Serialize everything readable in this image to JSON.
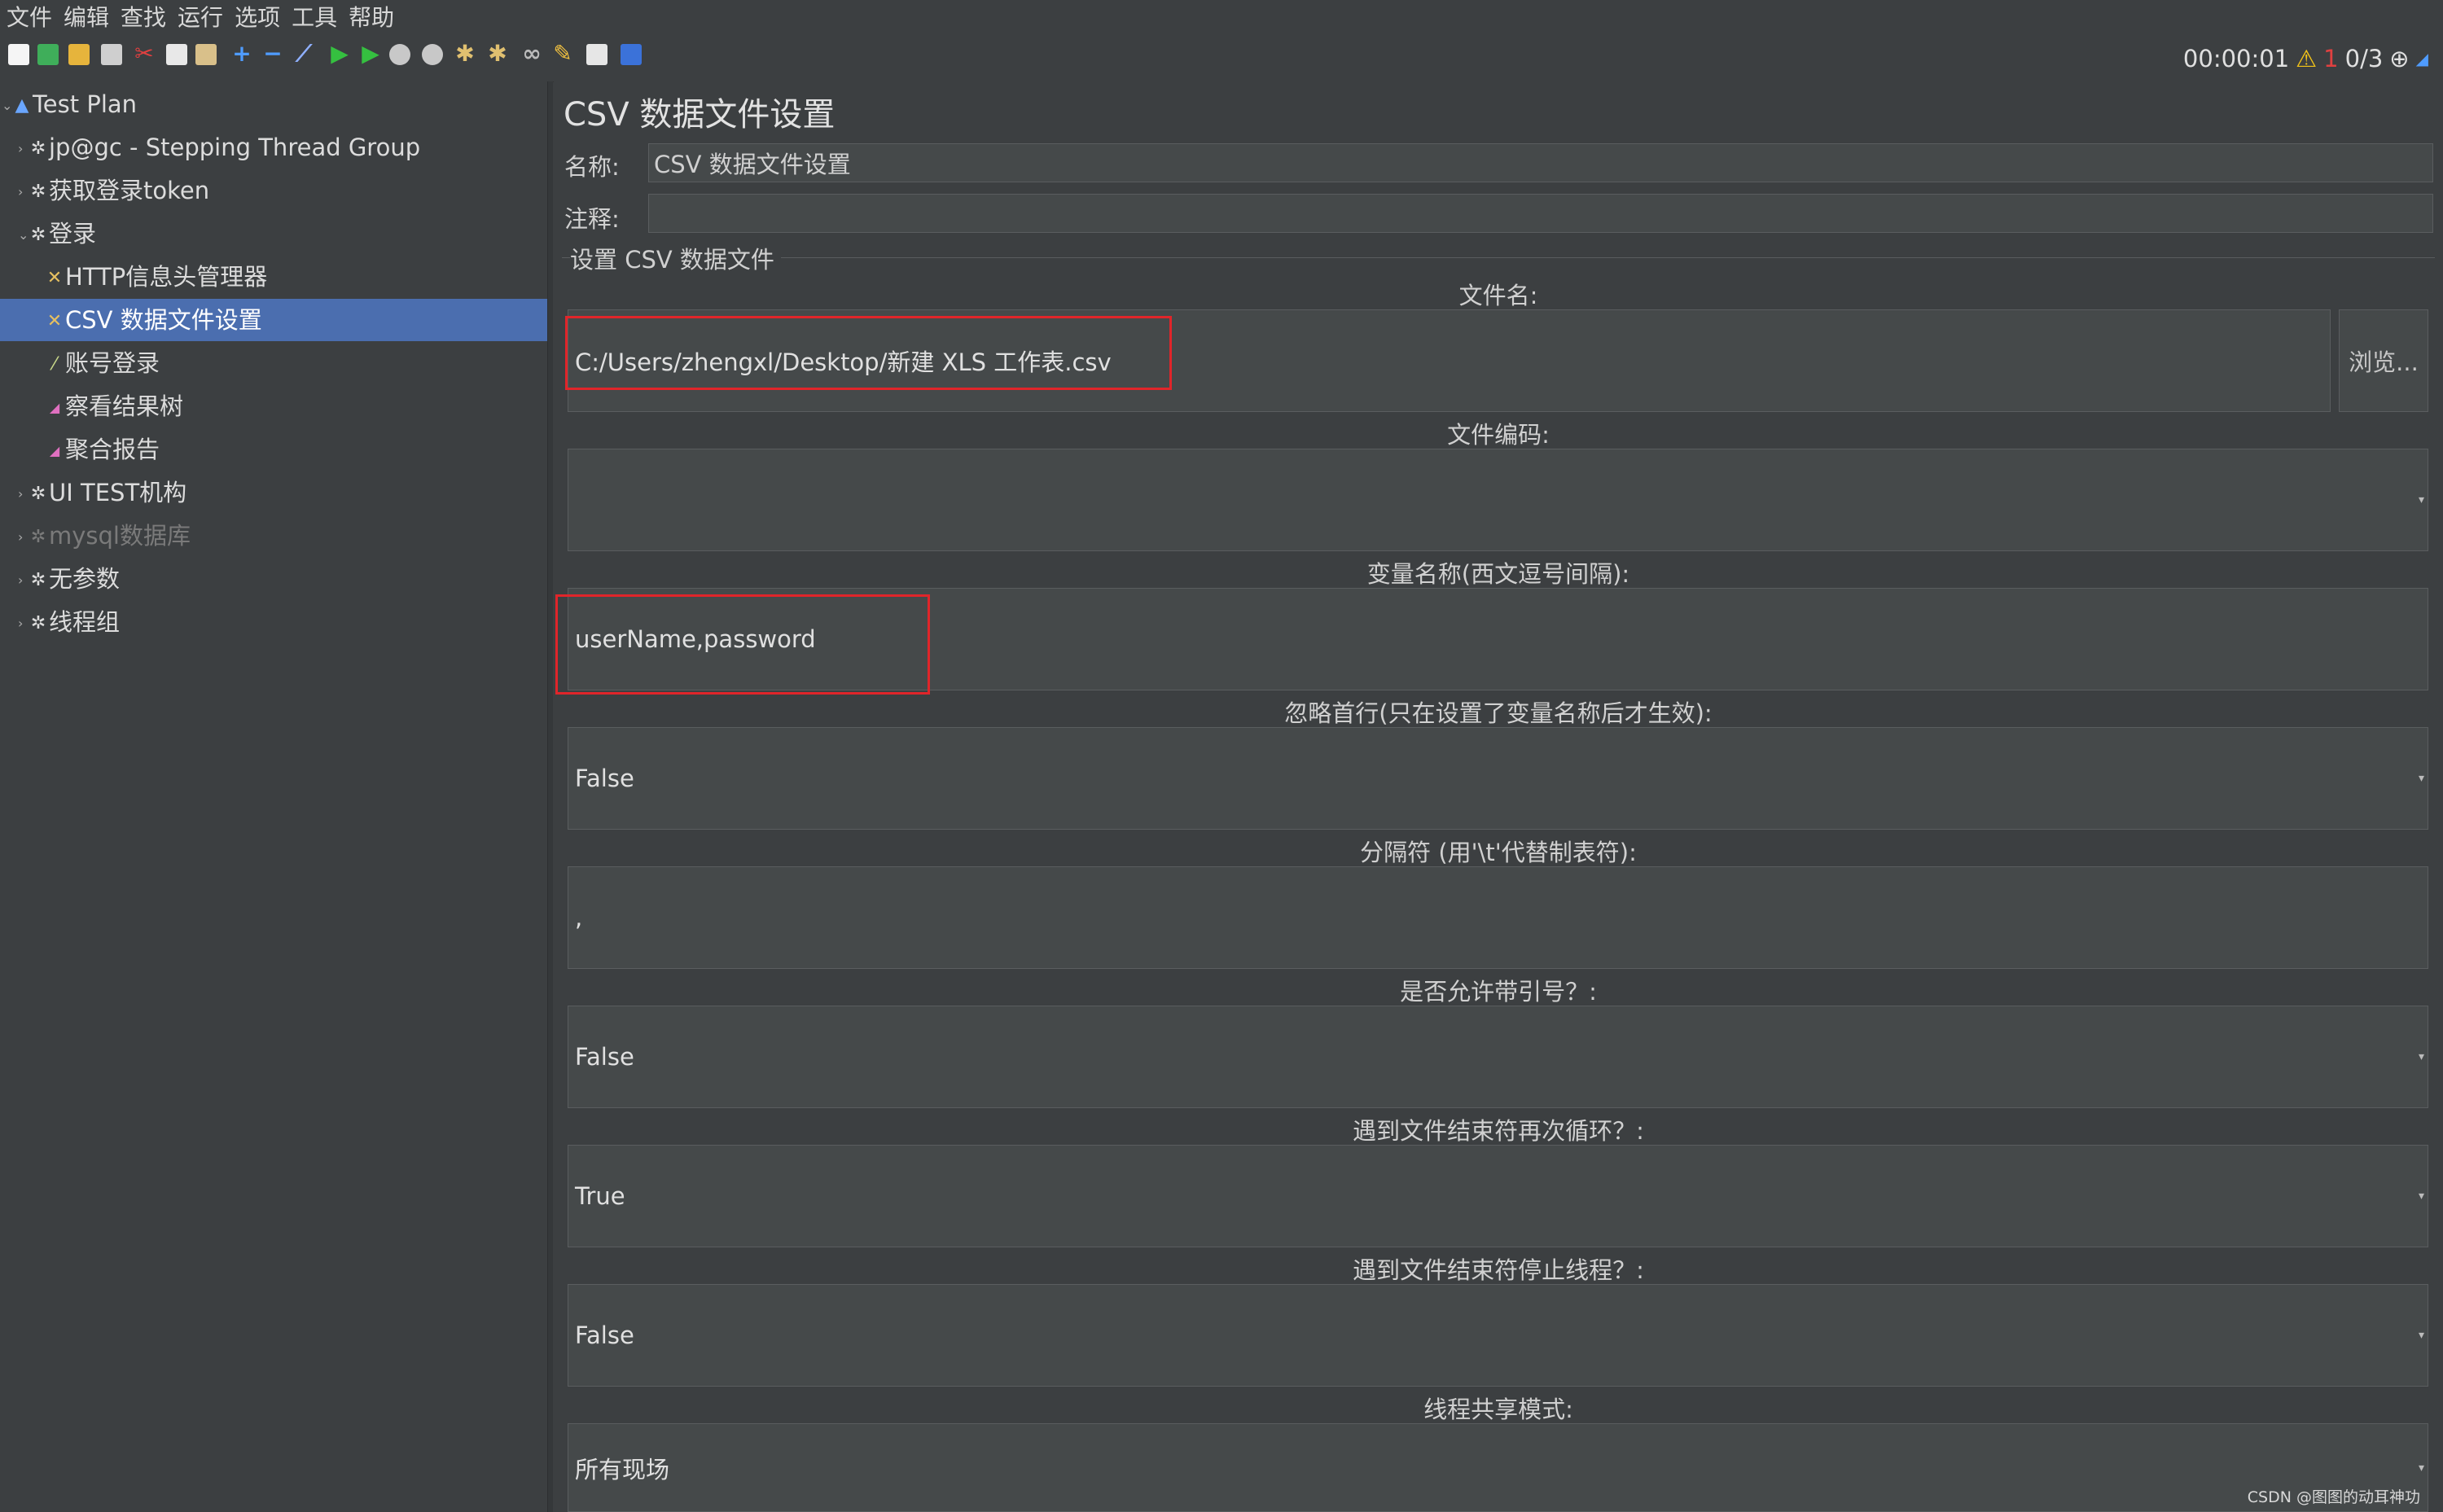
{
  "menu": [
    "文件",
    "编辑",
    "查找",
    "运行",
    "选项",
    "工具",
    "帮助"
  ],
  "status": {
    "timer": "00:00:01",
    "errors": "1",
    "threads": "0/3"
  },
  "tree": [
    {
      "label": "Test Plan"
    },
    {
      "label": "jp@gc - Stepping Thread Group"
    },
    {
      "label": "获取登录token"
    },
    {
      "label": "登录"
    },
    {
      "label": "HTTP信息头管理器"
    },
    {
      "label": "CSV 数据文件设置"
    },
    {
      "label": "账号登录"
    },
    {
      "label": "察看结果树"
    },
    {
      "label": "聚合报告"
    },
    {
      "label": "UI TEST机构"
    },
    {
      "label": "mysql数据库"
    },
    {
      "label": "无参数"
    },
    {
      "label": "线程组"
    }
  ],
  "panel": {
    "title": "CSV 数据文件设置",
    "name_label": "名称:",
    "name_value": "CSV 数据文件设置",
    "comment_label": "注释:",
    "comment_value": "",
    "group_title": "设置 CSV 数据文件",
    "filename_label": "文件名:",
    "filename_value": "C:/Users/zhengxl/Desktop/新建 XLS 工作表.csv",
    "browse_label": "浏览...",
    "encoding_label": "文件编码:",
    "encoding_value": "",
    "varnames_label": "变量名称(西文逗号间隔):",
    "varnames_value": "userName,password",
    "ignore_first_label": "忽略首行(只在设置了变量名称后才生效):",
    "ignore_first_value": "False",
    "delimiter_label": "分隔符 (用'\\t'代替制表符):",
    "delimiter_value": ",",
    "quoted_label": "是否允许带引号？:",
    "quoted_value": "False",
    "recycle_label": "遇到文件结束符再次循环？:",
    "recycle_value": "True",
    "stop_label": "遇到文件结束符停止线程？:",
    "stop_value": "False",
    "share_label": "线程共享模式:",
    "share_value": "所有现场"
  },
  "watermark": "CSDN @图图的动耳神功",
  "colors": {
    "background": "#3c3f41",
    "selection": "#4b6eaf",
    "highlight_box": "#e0252a"
  }
}
